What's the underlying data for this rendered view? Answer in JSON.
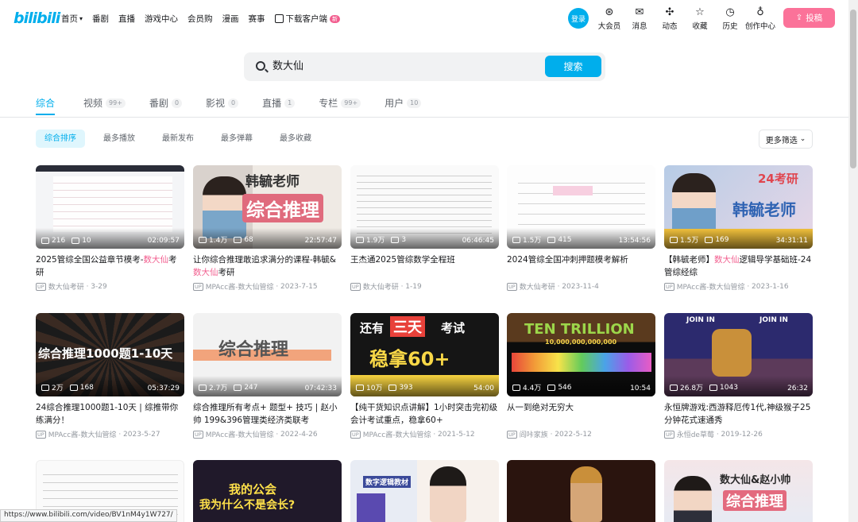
{
  "header": {
    "logo": "bilibili",
    "nav": [
      {
        "label": "首页",
        "has_chevron": true
      },
      {
        "label": "番剧"
      },
      {
        "label": "直播"
      },
      {
        "label": "游戏中心"
      },
      {
        "label": "会员购"
      },
      {
        "label": "漫画"
      },
      {
        "label": "赛事"
      }
    ],
    "download": {
      "label": "下载客户端",
      "badge": "新"
    },
    "login": "登录",
    "right_icons": [
      {
        "label": "大会员",
        "icon": "vip-icon"
      },
      {
        "label": "消息",
        "icon": "message-icon"
      },
      {
        "label": "动态",
        "icon": "dynamic-icon"
      },
      {
        "label": "收藏",
        "icon": "favorite-icon"
      },
      {
        "label": "历史",
        "icon": "history-icon"
      },
      {
        "label": "创作中心",
        "icon": "creator-icon"
      }
    ],
    "upload": "投稿"
  },
  "search": {
    "value": "数大仙",
    "button": "搜索"
  },
  "tabs": [
    {
      "label": "综合",
      "count": ""
    },
    {
      "label": "视频",
      "count": "99+"
    },
    {
      "label": "番剧",
      "count": "0"
    },
    {
      "label": "影视",
      "count": "0"
    },
    {
      "label": "直播",
      "count": "1"
    },
    {
      "label": "专栏",
      "count": "99+"
    },
    {
      "label": "用户",
      "count": "10"
    }
  ],
  "filters": [
    "综合排序",
    "最多播放",
    "最新发布",
    "最多弹幕",
    "最多收藏"
  ],
  "more_filter": "更多筛选",
  "videos": [
    {
      "plays": "216",
      "danmaku": "10",
      "duration": "02:09:57",
      "title_pre": "2025管综全国公益章节模考-",
      "title_hl": "数大仙",
      "title_post": "考研",
      "uploader": "数大仙考研",
      "date": "3-29"
    },
    {
      "plays": "1.4万",
      "danmaku": "68",
      "duration": "22:57:47",
      "title_pre": "让你综合推理敢追求满分的课程-韩毓&",
      "title_hl": "数大仙",
      "title_post": "考研",
      "uploader": "MPAcc酱-数大仙管综",
      "date": "2023-7-15",
      "thumb_text_1": "韩毓老师",
      "thumb_text_2": "综合推理"
    },
    {
      "plays": "1.9万",
      "danmaku": "3",
      "duration": "06:46:45",
      "title_pre": "王杰通2025管综数学全程班",
      "title_hl": "",
      "title_post": "",
      "uploader": "数大仙考研",
      "date": "1-19"
    },
    {
      "plays": "1.5万",
      "danmaku": "415",
      "duration": "13:54:56",
      "title_pre": "2024管综全国冲刺押题模考解析",
      "title_hl": "",
      "title_post": "",
      "uploader": "数大仙考研",
      "date": "2023-11-4"
    },
    {
      "plays": "1.5万",
      "danmaku": "169",
      "duration": "34:31:11",
      "title_pre": "【韩毓老师】",
      "title_hl": "数大仙",
      "title_post": "逻辑导学基础班-24管综经综",
      "uploader": "MPAcc酱-数大仙管综",
      "date": "2023-1-16",
      "thumb_text_1": "24考研",
      "thumb_text_2": "韩毓老师"
    },
    {
      "plays": "2万",
      "danmaku": "168",
      "duration": "05:37:29",
      "title_pre": "24综合推理1000题1-10天 | 综推带你练满分！",
      "title_hl": "",
      "title_post": "",
      "uploader": "MPAcc酱-数大仙管综",
      "date": "2023-5-27",
      "thumb_text_1": "综合推理1000题1-10天"
    },
    {
      "plays": "2.7万",
      "danmaku": "247",
      "duration": "07:42:33",
      "title_pre": "综合推理所有考点+ 题型+ 技巧 | 赵小帅 199&396管理类经济类联考",
      "title_hl": "",
      "title_post": "",
      "uploader": "MPAcc酱-数大仙管综",
      "date": "2022-4-26",
      "thumb_text_1": "综合推理"
    },
    {
      "plays": "10万",
      "danmaku": "393",
      "duration": "54:00",
      "title_pre": "【纯干货知识点讲解】1小时突击完初级会计考试重点，稳拿60+",
      "title_hl": "",
      "title_post": "",
      "uploader": "MPAcc酱-数大仙管综",
      "date": "2021-5-12",
      "thumb_text_1": "还有",
      "thumb_text_2": "三天",
      "thumb_text_3": "考试",
      "thumb_text_4": "稳拿60+"
    },
    {
      "plays": "4.4万",
      "danmaku": "546",
      "duration": "10:54",
      "title_pre": "从一到绝对无穷大",
      "title_hl": "",
      "title_post": "",
      "uploader": "阎咔家族",
      "date": "2022-5-12",
      "thumb_text_1": "TEN TRILLION",
      "thumb_text_2": "10,000,000,000,000"
    },
    {
      "plays": "26.8万",
      "danmaku": "1043",
      "duration": "26:32",
      "title_pre": "永恒牌游戏:西游释厄传1代,神级猴子25分钟花式速通秀",
      "title_hl": "",
      "title_post": "",
      "uploader": "永恒de草莓",
      "date": "2019-12-26",
      "thumb_text_1": "JOIN IN"
    },
    {
      "thumb_text_1": ""
    },
    {
      "thumb_text_1": "我的公会",
      "thumb_text_2": "我为什么不是会长?"
    },
    {
      "thumb_text_1": "数字逻辑教材"
    },
    {
      "thumb_text_1": ""
    },
    {
      "thumb_text_1": "数大仙&赵小帅",
      "thumb_text_2": "综合推理"
    }
  ],
  "status_url": "https://www.bilibili.com/video/BV1nM4y1W727/"
}
